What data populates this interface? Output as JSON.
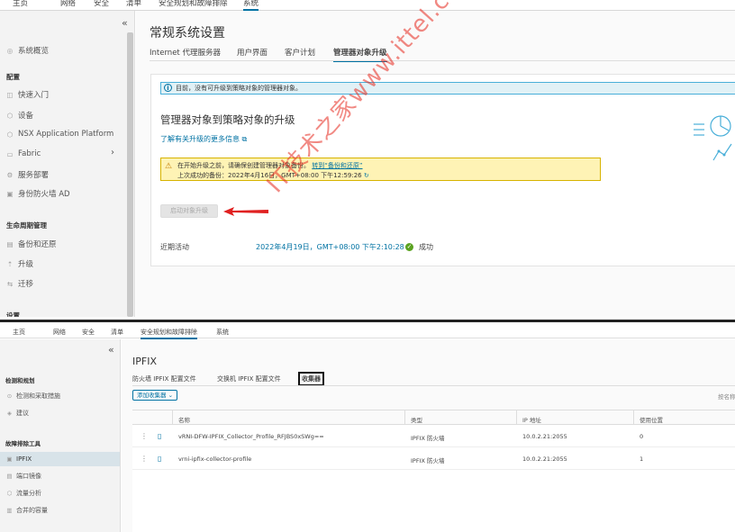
{
  "top": {
    "nav_tabs": [
      {
        "label": "主页"
      },
      {
        "label": "网络"
      },
      {
        "label": "安全"
      },
      {
        "label": "清单"
      },
      {
        "label": "安全规划和故障排除"
      },
      {
        "label": "系统",
        "active": true
      }
    ],
    "sidebar": {
      "collapse_glyph": "«",
      "items": [
        {
          "icon": "overview-icon",
          "glyph": "◎",
          "label": "系统概览"
        },
        {
          "section": "配置"
        },
        {
          "icon": "quickstart-icon",
          "glyph": "◫",
          "label": "快速入门"
        },
        {
          "icon": "device-icon",
          "glyph": "⬡",
          "label": "设备"
        },
        {
          "icon": "nsx-app-platform-icon",
          "glyph": "⬡",
          "label": "NSX Application Platform"
        },
        {
          "icon": "fabric-icon",
          "glyph": "▭",
          "label": "Fabric",
          "expandable": true
        },
        {
          "icon": "service-deploy-icon",
          "glyph": "⚙",
          "label": "服务部署"
        },
        {
          "icon": "identity-firewall-icon",
          "glyph": "▣",
          "label": "身份防火墙 AD"
        },
        {
          "section": "生命周期管理"
        },
        {
          "icon": "backup-icon",
          "glyph": "▤",
          "label": "备份和还原"
        },
        {
          "icon": "upgrade-icon",
          "glyph": "⇡",
          "label": "升级"
        },
        {
          "icon": "migrate-icon",
          "glyph": "⇆",
          "label": "迁移"
        },
        {
          "section": "设置"
        }
      ]
    },
    "title": "常规系统设置",
    "subtabs": [
      {
        "label": "Internet 代理服务器"
      },
      {
        "label": "用户界面"
      },
      {
        "label": "客户计划"
      },
      {
        "label": "管理器对象升级",
        "active": true
      }
    ],
    "info_banner": "目前，没有可升级到策略对象的管理器对象。",
    "card_title": "管理器对象到策略对象的升级",
    "learn_more": "了解有关升级的更多信息",
    "learn_more_icon": "external-link-icon",
    "warning": {
      "prefix": "在开始升级之前，请确保创建管理器对象备份。",
      "link": "转到“备份和还原”",
      "last_backup": "上次成功的备份：2022年4月16日，GMT+08:00 下午12:59:26"
    },
    "start_button": "启动对象升级",
    "recent_activity": {
      "label": "近期活动",
      "time": "2022年4月19日，GMT+08:00 下午2:10:28",
      "status": "成功"
    }
  },
  "bottom": {
    "nav_tabs": [
      {
        "label": "主页"
      },
      {
        "label": "网络"
      },
      {
        "label": "安全"
      },
      {
        "label": "清单"
      },
      {
        "label": "安全规划和故障排除",
        "active": true
      },
      {
        "label": "系统"
      }
    ],
    "sidebar": {
      "collapse_glyph": "«",
      "items": [
        {
          "section": "检测和规划"
        },
        {
          "icon": "detection-icon",
          "glyph": "⊙",
          "label": "检测和采取措施"
        },
        {
          "icon": "recommend-icon",
          "glyph": "◈",
          "label": "建议"
        },
        {
          "section": "故障排除工具"
        },
        {
          "icon": "ipfix-icon",
          "glyph": "▣",
          "label": "IPFIX",
          "active": true
        },
        {
          "icon": "port-mirror-icon",
          "glyph": "▤",
          "label": "端口镜像"
        },
        {
          "icon": "flow-analysis-icon",
          "glyph": "⬡",
          "label": "流量分析"
        },
        {
          "icon": "merged-capacity-icon",
          "glyph": "▥",
          "label": "合并的容量"
        }
      ]
    },
    "title": "IPFIX",
    "subtabs": [
      {
        "label": "防火墙 IPFIX 配置文件"
      },
      {
        "label": "交换机 IPFIX 配置文件"
      },
      {
        "label": "收集器",
        "active": true
      }
    ],
    "add_button": "添加收集器",
    "sort_label": "按名称",
    "table": {
      "headers": [
        "名称",
        "类型",
        "IP 地址",
        "使用位置"
      ],
      "rows": [
        {
          "name": "vRNI-DFW-IPFIX_Collector_Profile_RFJBS0xSWg==",
          "type": "IPFIX 防火墙",
          "ip": "10.0.2.21:2055",
          "usage": "0"
        },
        {
          "name": "vrni-ipfix-collector-profile",
          "type": "IPFIX 防火墙",
          "ip": "10.0.2.21:2055",
          "usage": "1"
        }
      ]
    }
  },
  "watermark": "IT技术之家www.ittel.cn"
}
